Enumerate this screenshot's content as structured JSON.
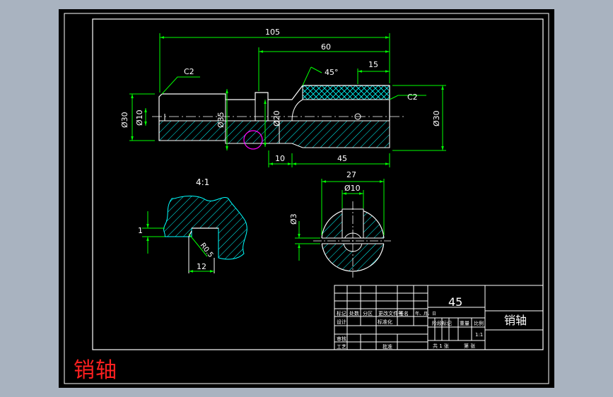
{
  "caption": "销轴",
  "colors": {
    "background": "#000000",
    "outline": "#ffffff",
    "dimension": "#00ff00",
    "hatch": "#00ffff",
    "highlight": "#ff00ff",
    "accent": "#ff2020"
  },
  "dimensions": {
    "overall_length": "105",
    "length_60": "60",
    "chamfer_angle": "45°",
    "length_15": "15",
    "chamfer_left": "C2",
    "chamfer_right": "C2",
    "dia_30_left": "Ø30",
    "dia_10": "Ø10",
    "dia_35": "Ø35",
    "dia_20": "Ø20",
    "dia_30_right": "Ø30",
    "length_10": "10",
    "length_45": "45",
    "detail_scale": "4:1",
    "detail_depth": "1",
    "detail_radius": "R0.5",
    "detail_width": "12",
    "section_width": "27",
    "section_hole": "Ø10",
    "section_dia3": "Ø3"
  },
  "title_block": {
    "material": "45",
    "part_name": "销轴",
    "row_labels": [
      "标记",
      "处数",
      "分区",
      "更改文件号",
      "签名",
      "年、月、日"
    ],
    "designer": "设计",
    "standardization": "标准化",
    "review": "审核",
    "process": "工艺",
    "approve": "批准",
    "stage_mark": "阶段标记",
    "weight": "重量",
    "scale_label": "比例",
    "scale_value": "1:1",
    "sheets_total": "共 1 张",
    "sheet_no": "第 张"
  }
}
